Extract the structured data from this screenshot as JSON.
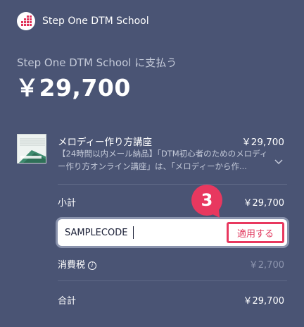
{
  "header": {
    "logo_icon": "step-one-logo-icon",
    "merchant_name": "Step One DTM School"
  },
  "payment": {
    "pay_to_label": "Step One DTM School に支払う",
    "total_amount": "￥29,700"
  },
  "product": {
    "name": "メロディー作り方講座",
    "price": "￥29,700",
    "description": "【24時間以内メール納品】「DTM初心者のためのメロディー作り方オンライン講座」は、「メロディーから作...",
    "thumbnail_text": "メロディー作り方講座",
    "expand_icon": "chevron-down-icon"
  },
  "summary": {
    "subtotal_label": "小計",
    "subtotal_value": "￥29,700",
    "promo_value": "SAMPLECODE",
    "apply_label": "適用する",
    "tax_label": "消費税",
    "tax_info_icon": "info-icon",
    "tax_value": "￥2,700",
    "total_label": "合計",
    "total_value": "￥29,700"
  },
  "annotation": {
    "step_number": "3"
  },
  "colors": {
    "background": "#4a5474",
    "accent": "#e8385f",
    "muted_text": "#c4cad9"
  }
}
